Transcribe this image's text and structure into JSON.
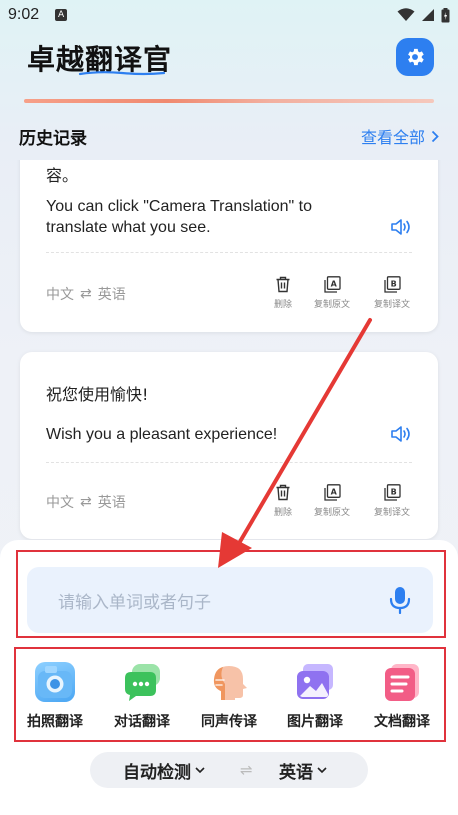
{
  "status_bar": {
    "time": "9:02",
    "notification_letter": "A"
  },
  "header": {
    "title": "卓越翻译官",
    "settings_icon": "gear-icon",
    "accent_color": "#2d7ff0"
  },
  "history": {
    "title": "历史记录",
    "view_all": "查看全部",
    "items": [
      {
        "source_text": "容。",
        "target_text": "You can click \"Camera Translation\" to translate what you see.",
        "lang_from": "中文",
        "lang_to": "英语",
        "actions": {
          "delete": "删除",
          "copy_source": "复制原文",
          "copy_target": "复制译文"
        }
      },
      {
        "source_text": "祝您使用愉快!",
        "target_text": "Wish you a pleasant experience!",
        "lang_from": "中文",
        "lang_to": "英语",
        "actions": {
          "delete": "删除",
          "copy_source": "复制原文",
          "copy_target": "复制译文"
        }
      }
    ]
  },
  "input": {
    "placeholder": "请输入单词或者句子"
  },
  "tools": [
    {
      "label": "拍照翻译",
      "icon": "camera-icon"
    },
    {
      "label": "对话翻译",
      "icon": "chat-icon"
    },
    {
      "label": "同声传译",
      "icon": "head-profile-icon"
    },
    {
      "label": "图片翻译",
      "icon": "image-icon"
    },
    {
      "label": "文档翻译",
      "icon": "document-icon"
    }
  ],
  "language_switch": {
    "from": "自动检测",
    "swap": "⇌",
    "to": "英语"
  },
  "colors": {
    "accent": "#2d7ff0",
    "highlight_red": "#e0323c",
    "arrow_red": "#e53935"
  }
}
